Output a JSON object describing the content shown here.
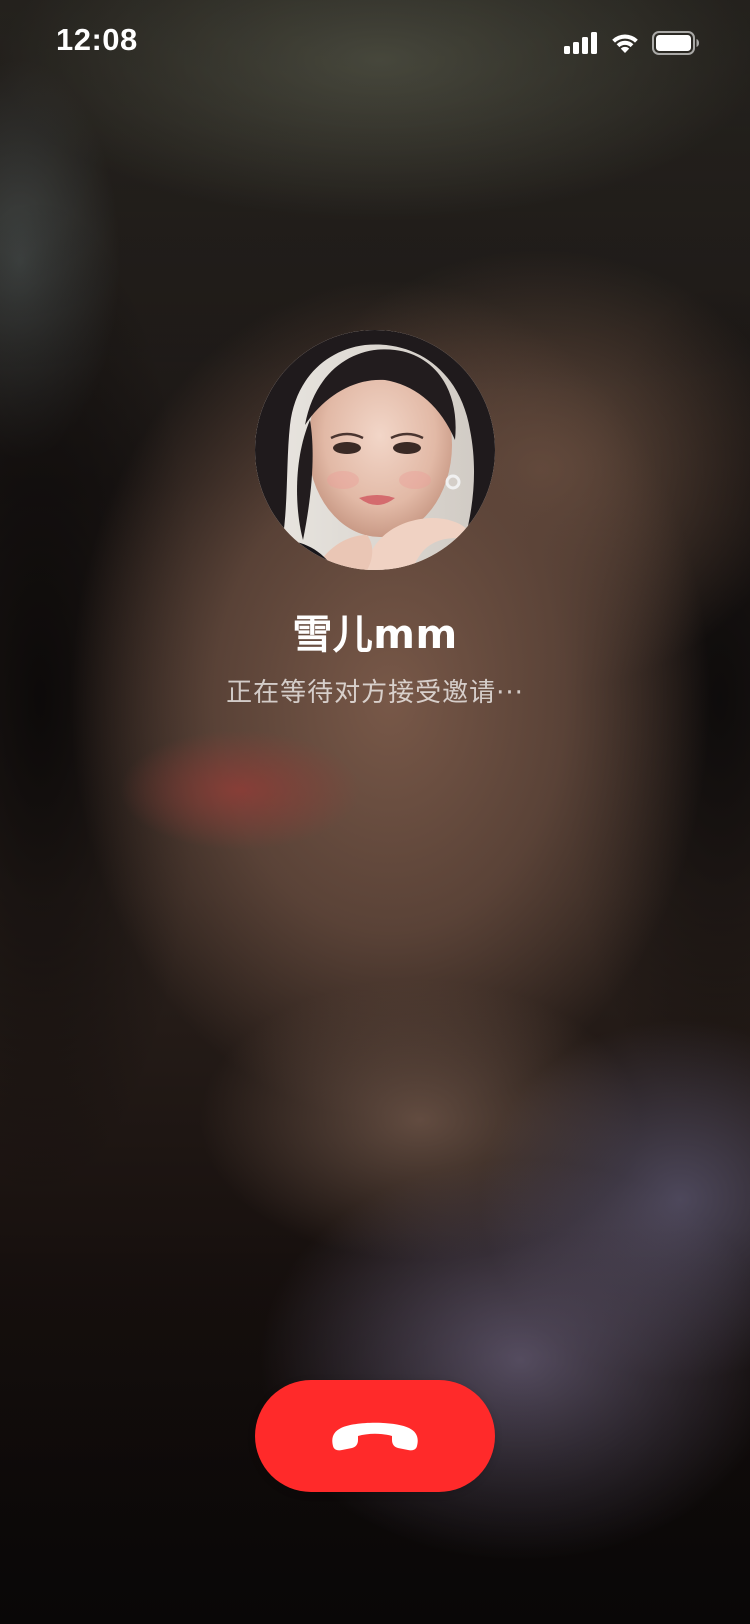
{
  "status_bar": {
    "time": "12:08",
    "icons": [
      "signal-icon",
      "wifi-icon",
      "battery-icon"
    ]
  },
  "caller": {
    "name": "雪儿mm",
    "status": "正在等待对方接受邀请···"
  },
  "actions": {
    "hangup_icon": "phone-hangup-icon",
    "hangup_color": "#ff2a2a"
  }
}
